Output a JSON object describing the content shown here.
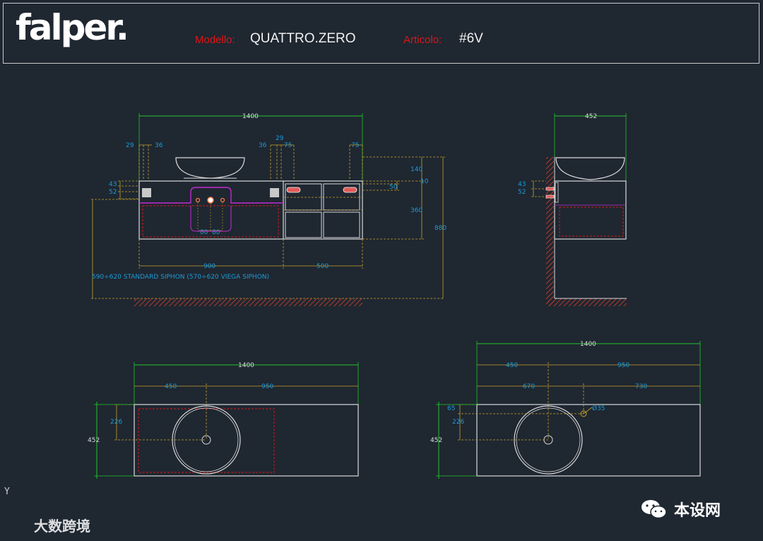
{
  "header": {
    "logo": "falper.",
    "model_label": "Modello:",
    "model_value": "QUATTRO.ZERO",
    "article_label": "Articolo:",
    "article_value": "#6V"
  },
  "front_view": {
    "overall_width": "1400",
    "dim_29_left": "29",
    "dim_36_left": "36",
    "dim_36_mid": "36",
    "dim_29_mid": "29",
    "dim_75_mid": "75",
    "dim_75_right": "75",
    "dim_43": "43",
    "dim_52": "52",
    "dim_140": "140",
    "dim_50": "50",
    "dim_10": "10",
    "dim_360": "360",
    "dim_880": "880",
    "dim_80a": "80",
    "dim_80b": "80",
    "dim_900": "900",
    "dim_500": "500",
    "siphon_note": "590÷620 STANDARD SIPHON (570÷620 VIEGA SIPHON)"
  },
  "side_view": {
    "depth": "452",
    "dim_43": "43",
    "dim_52": "52"
  },
  "plan_left": {
    "overall_width": "1400",
    "dim_450": "450",
    "dim_950": "950",
    "dim_226": "226",
    "dim_452": "452"
  },
  "plan_right": {
    "overall_width": "1400",
    "dim_450": "450",
    "dim_950": "950",
    "dim_670": "670",
    "dim_730": "730",
    "dim_65": "65",
    "dim_226": "226",
    "dim_452": "452",
    "hole_diameter": "Ø35"
  },
  "ucs_label": "Y",
  "watermark": {
    "text": "本设网",
    "corner": "大数跨境"
  },
  "colors": {
    "background": "#1f2731",
    "outline": "#d9d9d9",
    "dimension_green": "#22c42a",
    "dimension_yellow": "#c8a22a",
    "dimension_text_blue": "#1d9bd6",
    "hidden_red": "#d01818",
    "header_label_red": "#e01515",
    "basin_purple": "#c02ad0",
    "hatch_red": "#b43a2a"
  }
}
